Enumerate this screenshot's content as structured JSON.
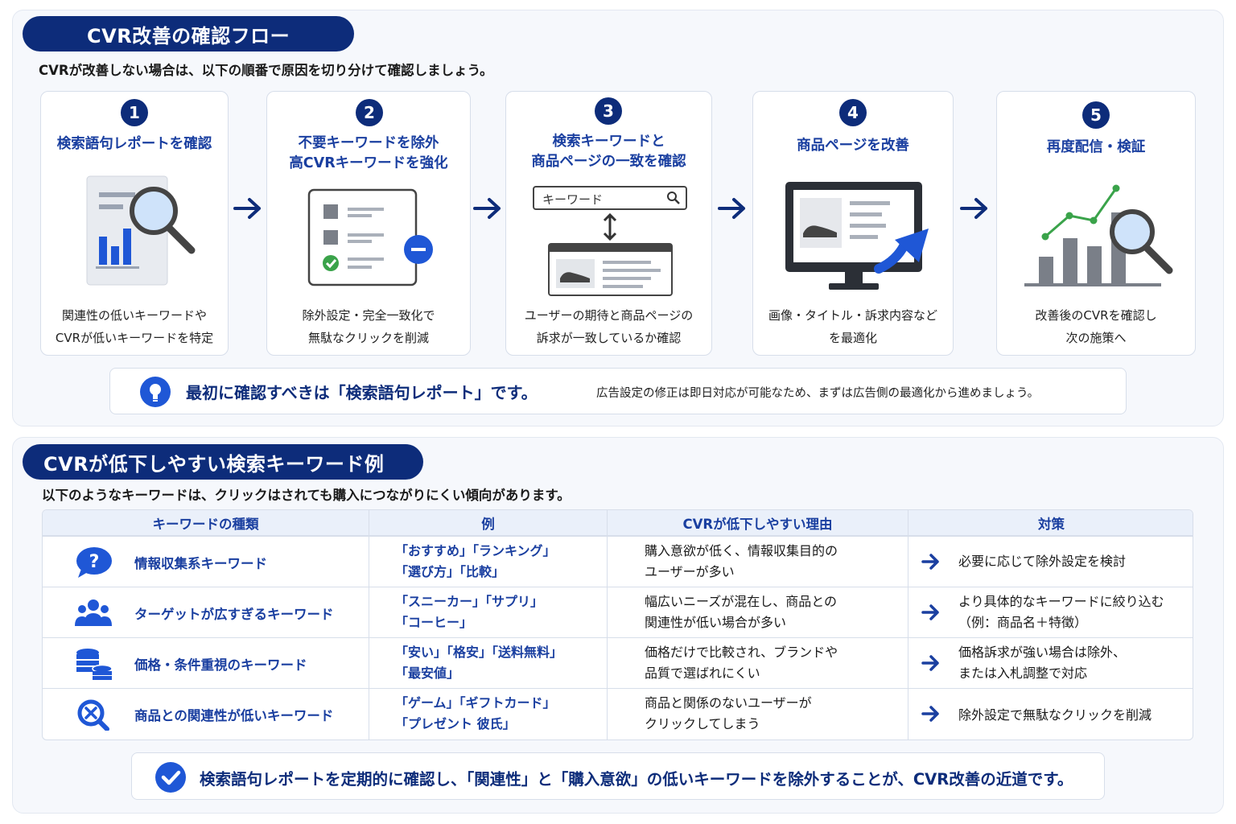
{
  "section1": {
    "title": "CVR改善の確認フロー",
    "subtitle": "CVRが改善しない場合は、以下の順番で原因を切り分けて確認しましょう。",
    "steps": [
      {
        "num": "1",
        "title": [
          "検索語句レポートを確認"
        ],
        "desc": [
          "関連性の低いキーワードや",
          "CVRが低いキーワードを特定"
        ],
        "icon": "report-magnifier-icon"
      },
      {
        "num": "2",
        "title": [
          "不要キーワードを除外",
          "高CVRキーワードを強化"
        ],
        "desc": [
          "除外設定・完全一致化で",
          "無駄なクリックを削減"
        ],
        "icon": "checklist-remove-icon"
      },
      {
        "num": "3",
        "title": [
          "検索キーワードと",
          "商品ページの一致を確認"
        ],
        "desc": [
          "ユーザーの期待と商品ページの",
          "訴求が一致しているか確認"
        ],
        "icon": "keyword-page-match-icon",
        "search_placeholder": "キーワード"
      },
      {
        "num": "4",
        "title": [
          "商品ページを改善"
        ],
        "desc": [
          "画像・タイトル・訴求内容など",
          "を最適化"
        ],
        "icon": "monitor-improve-icon"
      },
      {
        "num": "5",
        "title": [
          "再度配信・検証"
        ],
        "desc": [
          "改善後のCVRを確認し",
          "次の施策へ"
        ],
        "icon": "chart-magnifier-icon"
      }
    ],
    "tip": {
      "main": "最初に確認すべきは「検索語句レポート」です。",
      "sub": "広告設定の修正は即日対応が可能なため、まずは広告側の最適化から進めましょう。",
      "icon": "lightbulb-icon"
    }
  },
  "section2": {
    "title": "CVRが低下しやすい検索キーワード例",
    "subtitle": "以下のようなキーワードは、クリックはされても購入につながりにくい傾向があります。",
    "headers": [
      "キーワードの種類",
      "例",
      "CVRが低下しやすい理由",
      "対策"
    ],
    "rows": [
      {
        "icon": "question-bubble-icon",
        "category": "情報収集系キーワード",
        "examples": [
          "「おすすめ」「ランキング」",
          "「選び方」「比較」"
        ],
        "reason": [
          "購入意欲が低く、情報収集目的の",
          "ユーザーが多い"
        ],
        "action": [
          "必要に応じて除外設定を検討"
        ]
      },
      {
        "icon": "people-group-icon",
        "category": "ターゲットが広すぎるキーワード",
        "examples": [
          "「スニーカー」「サプリ」",
          "「コーヒー」"
        ],
        "reason": [
          "幅広いニーズが混在し、商品との",
          "関連性が低い場合が多い"
        ],
        "action": [
          "より具体的なキーワードに絞り込む",
          "（例：商品名＋特徴）"
        ]
      },
      {
        "icon": "coin-stack-icon",
        "category": "価格・条件重視のキーワード",
        "examples": [
          "「安い」「格安」「送料無料」",
          "「最安値」"
        ],
        "reason": [
          "価格だけで比較され、ブランドや",
          "品質で選ばれにくい"
        ],
        "action": [
          "価格訴求が強い場合は除外、",
          "または入札調整で対応"
        ]
      },
      {
        "icon": "search-x-icon",
        "category": "商品との関連性が低いキーワード",
        "examples": [
          "「ゲーム」「ギフトカード」",
          "「プレゼント 彼氏」"
        ],
        "reason": [
          "商品と関係のないユーザーが",
          "クリックしてしまう"
        ],
        "action": [
          "除外設定で無駄なクリックを削減"
        ]
      }
    ],
    "conclusion": {
      "text": "検索語句レポートを定期的に確認し、「関連性」と「購入意欲」の低いキーワードを除外することが、CVR改善の近道です。",
      "icon": "check-circle-icon"
    }
  },
  "colors": {
    "navy": "#0d2c7a",
    "accent_blue": "#1a3fa0",
    "bright_blue": "#1f57d6",
    "green": "#3aa34a",
    "panel_bg": "#f6f8fc"
  }
}
